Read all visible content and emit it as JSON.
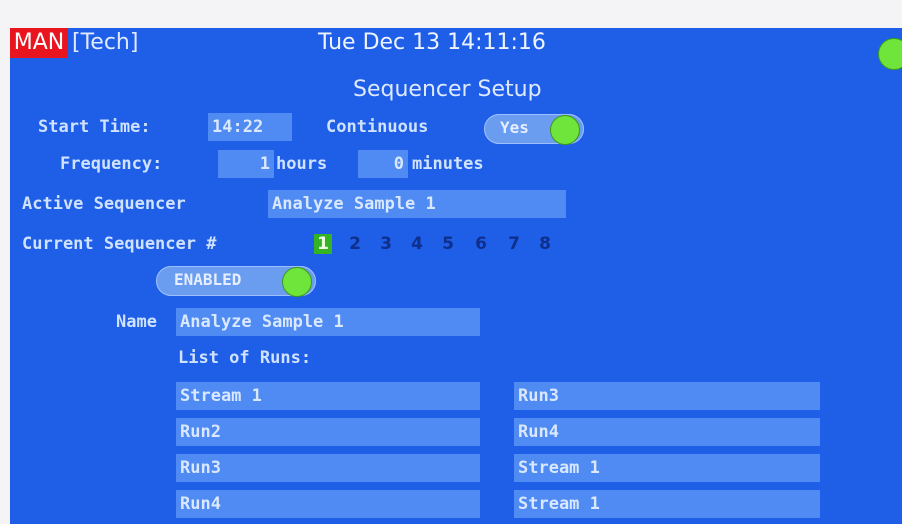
{
  "header": {
    "mode": "MAN",
    "user": "[Tech]",
    "datetime": "Tue Dec 13 14:11:16"
  },
  "page_title": "Sequencer Setup",
  "start_time": {
    "label": "Start Time:",
    "value": "14:22"
  },
  "continuous": {
    "label": "Continuous",
    "value": "Yes"
  },
  "frequency": {
    "label": "Frequency:",
    "hours_value": "1",
    "hours_unit": "hours",
    "minutes_value": "0",
    "minutes_unit": "minutes"
  },
  "active_sequencer": {
    "label": "Active Sequencer",
    "value": "Analyze Sample 1"
  },
  "current_sequencer": {
    "label": "Current Sequencer #",
    "numbers": [
      "1",
      "2",
      "3",
      "4",
      "5",
      "6",
      "7",
      "8"
    ],
    "selected": "1"
  },
  "enabled_toggle": {
    "label": "ENABLED"
  },
  "name_field": {
    "label": "Name",
    "value": "Analyze Sample 1"
  },
  "runs": {
    "label": "List of Runs:",
    "left": [
      "Stream 1",
      "Run2",
      "Run3",
      "Run4"
    ],
    "right": [
      "Run3",
      "Run4",
      "Stream 1",
      "Stream 1"
    ]
  },
  "colors": {
    "background": "#1f5fe8",
    "field": "#4f8bf2",
    "mode_badge": "#e8141e",
    "toggle_on": "#6fe43a"
  }
}
